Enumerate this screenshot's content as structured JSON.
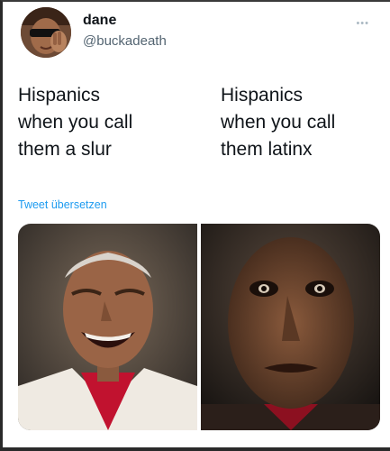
{
  "tweet": {
    "author": {
      "display_name": "dane",
      "handle": "@buckadeath"
    },
    "more_icon": "more-dots-icon",
    "captions": {
      "left": "Hispanics\nwhen you call\nthem a slur",
      "right": "Hispanics\nwhen you call\nthem latinx"
    },
    "translate_label": "Tweet übersetzen",
    "colors": {
      "link": "#1d9bf0",
      "text": "#0f1419",
      "secondary": "#536471"
    },
    "media": {
      "left_image": "laughing-man-photo",
      "right_image": "serious-man-photo"
    }
  }
}
